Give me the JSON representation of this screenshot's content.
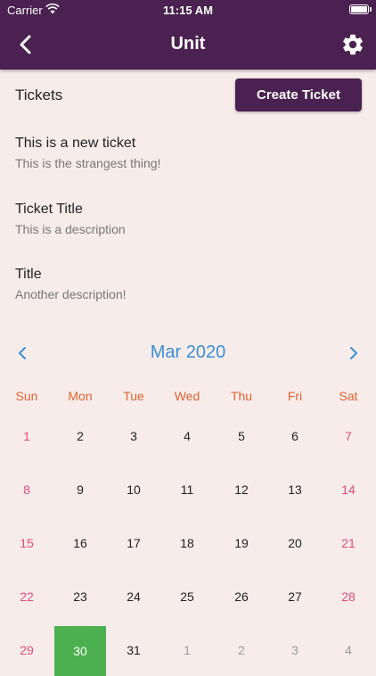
{
  "status_bar": {
    "carrier": "Carrier",
    "time": "11:15 AM"
  },
  "nav": {
    "title": "Unit",
    "back_icon": "chevron-left-icon",
    "settings_icon": "gear-icon"
  },
  "tickets": {
    "label": "Tickets",
    "create_label": "Create Ticket",
    "items": [
      {
        "title": "This is a new ticket",
        "description": "This is the strangest thing!"
      },
      {
        "title": "Ticket Title",
        "description": "This is a description"
      },
      {
        "title": "Title",
        "description": "Another description!"
      }
    ]
  },
  "calendar": {
    "month_label": "Mar 2020",
    "weekdays": [
      "Sun",
      "Mon",
      "Tue",
      "Wed",
      "Thu",
      "Fri",
      "Sat"
    ],
    "weeks": [
      [
        "1",
        "2",
        "3",
        "4",
        "5",
        "6",
        "7"
      ],
      [
        "8",
        "9",
        "10",
        "11",
        "12",
        "13",
        "14"
      ],
      [
        "15",
        "16",
        "17",
        "18",
        "19",
        "20",
        "21"
      ],
      [
        "22",
        "23",
        "24",
        "25",
        "26",
        "27",
        "28"
      ],
      [
        "29",
        "30",
        "31",
        "1",
        "2",
        "3",
        "4"
      ]
    ],
    "selected_day": "30",
    "colors": {
      "header": "#3a8fd6",
      "weekday": "#e0632e",
      "weekend": "#e04a7a",
      "selected": "#4caf50"
    }
  },
  "colors": {
    "primary": "#4a2150",
    "background": "#f7ecea"
  }
}
